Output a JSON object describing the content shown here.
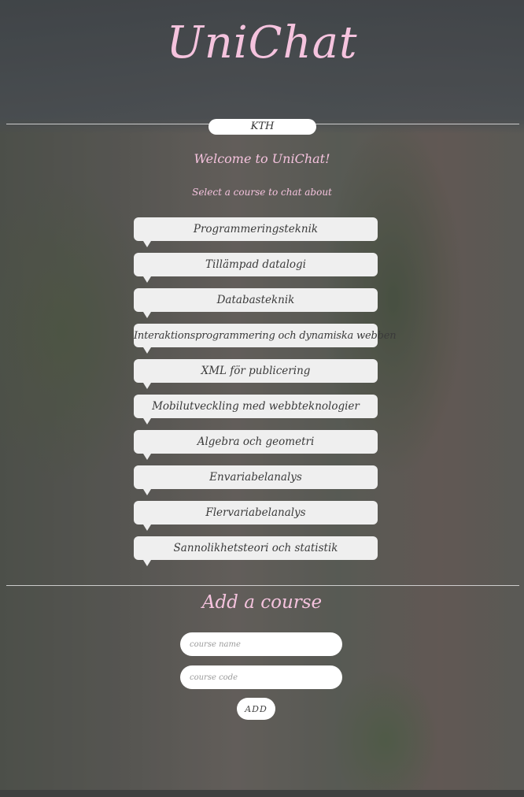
{
  "header": {
    "app_title": "UniChat"
  },
  "school": {
    "name": "KTH"
  },
  "welcome": {
    "text": "Welcome to UniChat!",
    "subtitle": "Select a course to chat about"
  },
  "courses": [
    "Programmeringsteknik",
    "Tillämpad datalogi",
    "Databasteknik",
    "Interaktionsprogrammering och dynamiska webben",
    "XML för publicering",
    "Mobilutveckling med webbteknologier",
    "Algebra och geometri",
    "Envariabelanalys",
    "Flervariabelanalys",
    "Sannolikhetsteori och statistik"
  ],
  "add_course": {
    "title": "Add a course",
    "name_placeholder": "course name",
    "code_placeholder": "course code",
    "button_label": "ADD"
  },
  "colors": {
    "accent_pink": "#f5c3de",
    "bubble": "#efefef"
  }
}
